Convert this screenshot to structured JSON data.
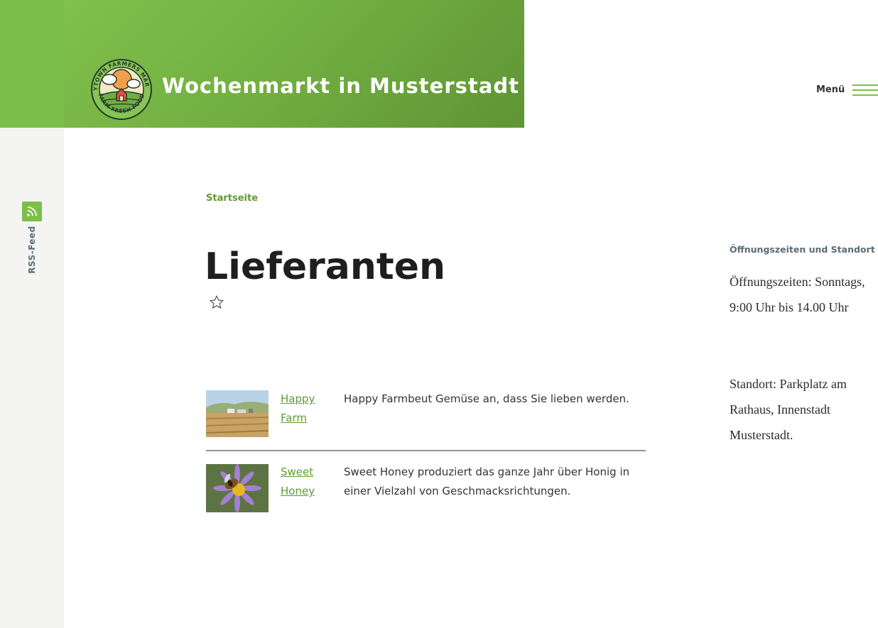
{
  "header": {
    "logo_alt": "Anytown Farmers Market",
    "site_title": "Wochenmarkt in Musterstadt",
    "menu_label": "Menü"
  },
  "rss": {
    "label": "RSS-Feed"
  },
  "breadcrumb": {
    "home": "Startseite"
  },
  "page": {
    "title": "Lieferanten"
  },
  "suppliers": [
    {
      "name": "Happy Farm",
      "description": "Happy Farmbeut Gemüse an, dass Sie lieben werden."
    },
    {
      "name": "Sweet Honey",
      "description": "Sweet Honey produziert das ganze Jahr über Honig in einer Vielzahl von Geschmacksrichtungen."
    }
  ],
  "sidebar": {
    "heading": "Öffnungszeiten und Standort",
    "hours": "Öffnungszeiten: Sonntags, 9:00 Uhr bis 14.00 Uhr",
    "location": "Standort: Parkplatz am Rathaus, Innenstadt Musterstadt."
  },
  "colors": {
    "brand_green": "#7cbf4a",
    "link_green": "#5f9a35",
    "muted_slate": "#5a6b78"
  }
}
